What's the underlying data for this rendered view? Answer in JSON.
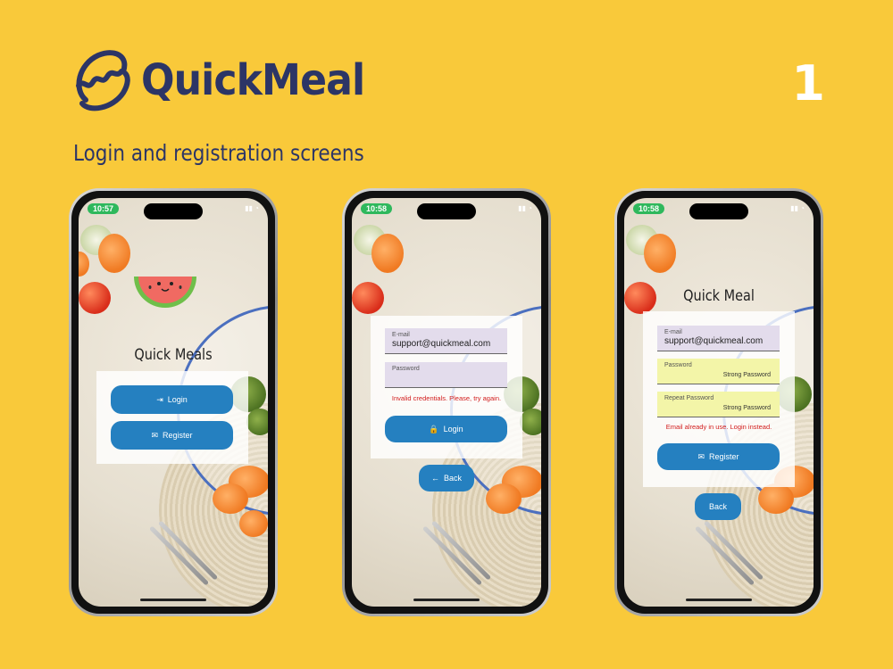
{
  "brand": {
    "name": "QuickMeal",
    "subtitle": "Login and registration screens",
    "page_number": "1",
    "color": "#2c3566",
    "background": "#f9c93a",
    "button_color": "#2580c0",
    "error_color": "#d21c1c"
  },
  "screens": [
    {
      "time": "10:57",
      "title": "Quick Meals",
      "buttons": [
        {
          "label": "Login",
          "icon": "login-icon"
        },
        {
          "label": "Register",
          "icon": "mail-icon"
        }
      ]
    },
    {
      "time": "10:58",
      "email": {
        "label": "E-mail",
        "value": "support@quickmeal.com"
      },
      "password": {
        "label": "Password"
      },
      "error": "Invalid credentials. Please, try again.",
      "login_button": {
        "label": "Login",
        "icon": "lock-icon"
      },
      "back_button": {
        "label": "Back",
        "icon": "arrow-left-icon"
      }
    },
    {
      "time": "10:58",
      "title": "Quick Meal",
      "email": {
        "label": "E-mail",
        "value": "support@quickmeal.com"
      },
      "password": {
        "label": "Password",
        "hint": "Strong Password"
      },
      "repeat_password": {
        "label": "Repeat Password",
        "hint": "Strong Password"
      },
      "error": "Email already in use. Login instead.",
      "register_button": {
        "label": "Register",
        "icon": "mail-icon"
      },
      "back_button": {
        "label": "Back"
      }
    }
  ]
}
